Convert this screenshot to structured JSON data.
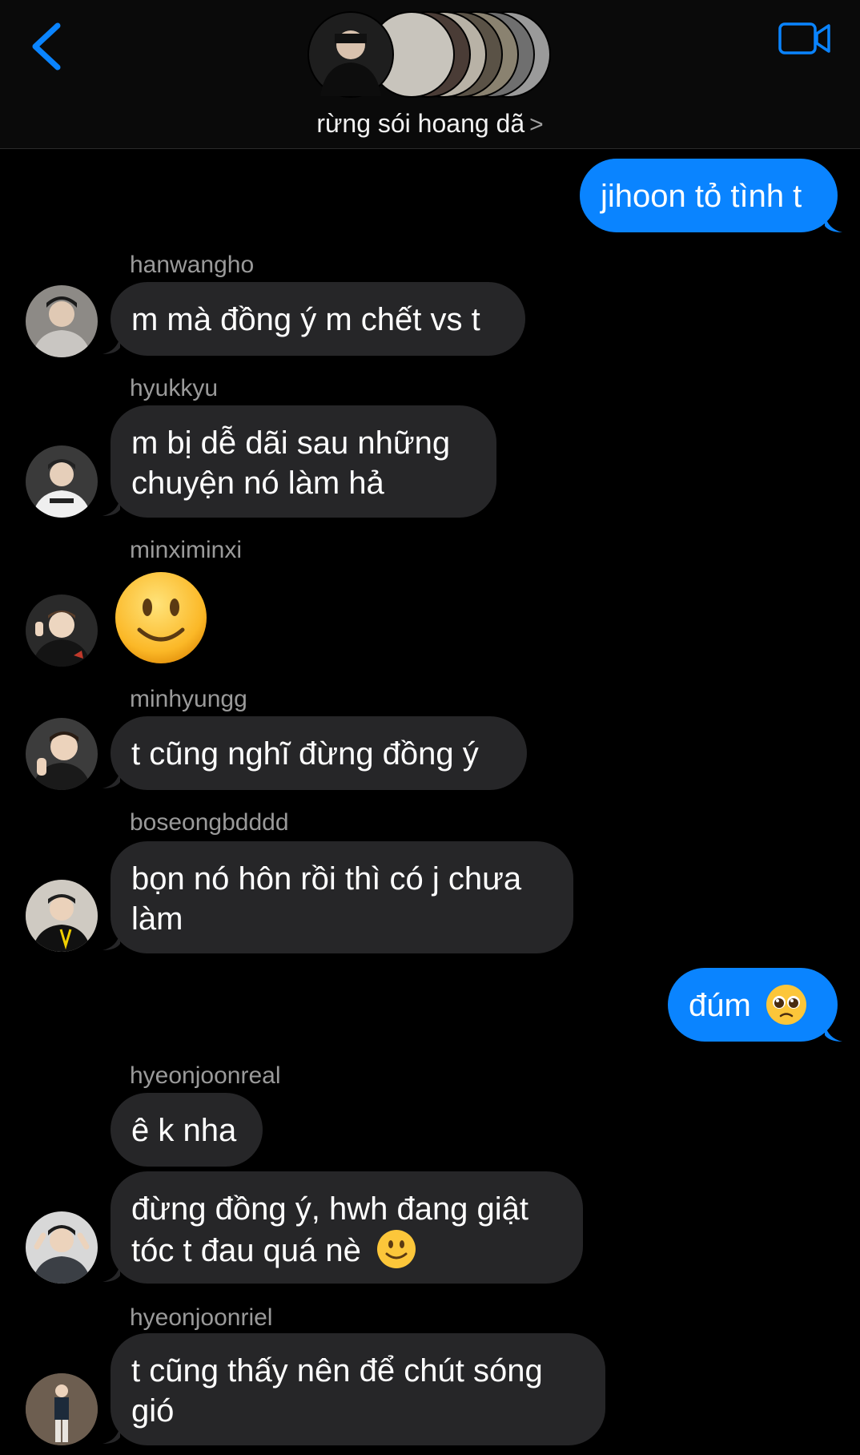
{
  "header": {
    "group_name": "rừng sói hoang dã",
    "chevron": ">",
    "back_icon": "chevron-left-icon",
    "video_icon": "video-camera-icon",
    "accent": "#0a84ff"
  },
  "messages": [
    {
      "from": "me",
      "text": "jihoon tỏ tình t"
    },
    {
      "from": "hanwangho",
      "sender_label": "hanwangho",
      "text": "m mà đồng ý m chết vs t"
    },
    {
      "from": "hyukkyu",
      "sender_label": "hyukkyu",
      "text": "m bị dễ dãi sau những chuyện nó làm hả"
    },
    {
      "from": "minximinxi",
      "sender_label": "minximinxi",
      "emoji": "slightly-smiling-face"
    },
    {
      "from": "minhyungg",
      "sender_label": "minhyungg",
      "text": "t cũng nghĩ đừng đồng ý"
    },
    {
      "from": "boseongbdddd",
      "sender_label": "boseongbdddd",
      "text": "bọn nó hôn rồi thì có j chưa làm"
    },
    {
      "from": "me",
      "text": "đúm"
    },
    {
      "from": "hyeonjoonreal",
      "sender_label": "hyeonjoonreal",
      "text": "ê k nha"
    },
    {
      "from": "hyeonjoonreal",
      "text": "đừng đồng ý, hwh đang giật tóc t đau quá nè"
    },
    {
      "from": "hyeonjoonriel",
      "sender_label": "hyeonjoonriel",
      "text": "t cũng thấy nên để chút sóng gió"
    }
  ],
  "ui": {
    "line1": {
      "m1": "jihoon tỏ tình t"
    },
    "m2": "m mà đồng ý m chết vs t",
    "m3a": "m bị dễ dãi sau những",
    "m3b": "chuyện nó làm hả",
    "m5": "t cũng nghĩ đừng đồng ý",
    "m6a": "bọn nó hôn rồi thì có j chưa",
    "m6b": "làm",
    "m7": "đúm",
    "m8": "ê k nha",
    "m9a": "đừng đồng ý, hwh đang giật",
    "m9b": "tóc t đau quá nè",
    "m10a": "t cũng thấy nên để chút sóng",
    "m10b": "gió"
  }
}
